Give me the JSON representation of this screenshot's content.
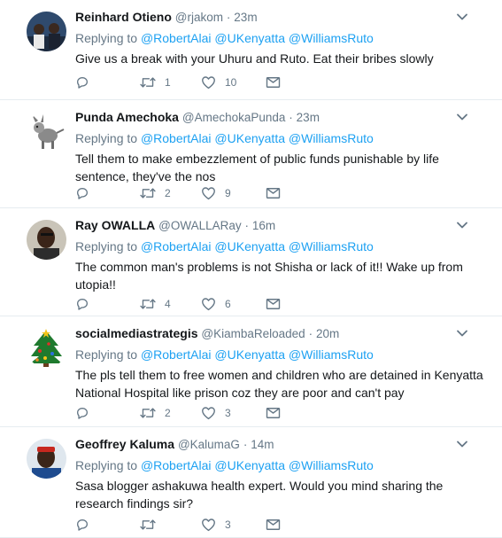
{
  "tweets": [
    {
      "name": "Reinhard Otieno",
      "handle": "@rjakom",
      "time": "23m",
      "replying": "Replying to",
      "mentions": [
        "@RobertAlai",
        "@UKenyatta",
        "@WilliamsRuto"
      ],
      "text": "Give us a break with your Uhuru and Ruto. Eat their bribes slowly",
      "retweets": "1",
      "likes": "10",
      "replies": ""
    },
    {
      "name": "Punda Amechoka",
      "handle": "@AmechokaPunda",
      "time": "23m",
      "replying": "Replying to",
      "mentions": [
        "@RobertAlai",
        "@UKenyatta",
        "@WilliamsRuto"
      ],
      "text": "Tell them to make embezzlement of public funds punishable by life sentence, they've the nos",
      "retweets": "2",
      "likes": "9",
      "replies": ""
    },
    {
      "name": "Ray OWALLA",
      "handle": "@OWALLARay",
      "time": "16m",
      "replying": "Replying to",
      "mentions": [
        "@RobertAlai",
        "@UKenyatta",
        "@WilliamsRuto"
      ],
      "text": "The common man's problems is not Shisha or lack of it!! Wake up from utopia!!",
      "retweets": "4",
      "likes": "6",
      "replies": ""
    },
    {
      "name": "socialmediastrategis",
      "handle": "@KiambaReloaded",
      "time": "20m",
      "replying": "Replying to",
      "mentions": [
        "@RobertAlai",
        "@UKenyatta",
        "@WilliamsRuto"
      ],
      "text": "The pls tell them to free women and children who are detained in Kenyatta National Hospital like prison coz they are poor and can't pay",
      "retweets": "2",
      "likes": "3",
      "replies": ""
    },
    {
      "name": "Geoffrey Kaluma",
      "handle": "@KalumaG",
      "time": "14m",
      "replying": "Replying to",
      "mentions": [
        "@RobertAlai",
        "@UKenyatta",
        "@WilliamsRuto"
      ],
      "text": "Sasa blogger ashakuwa health expert. Would you mind sharing the research findings sir?",
      "retweets": "",
      "likes": "3",
      "replies": ""
    }
  ],
  "separator": "·",
  "colors": {
    "accent": "#1da1f2",
    "muted": "#657786",
    "text": "#14171a",
    "border": "#e6ecf0"
  },
  "icons": {
    "reply": "reply-icon",
    "retweet": "retweet-icon",
    "like": "heart-icon",
    "dm": "envelope-icon",
    "menu": "chevron-down-icon"
  }
}
